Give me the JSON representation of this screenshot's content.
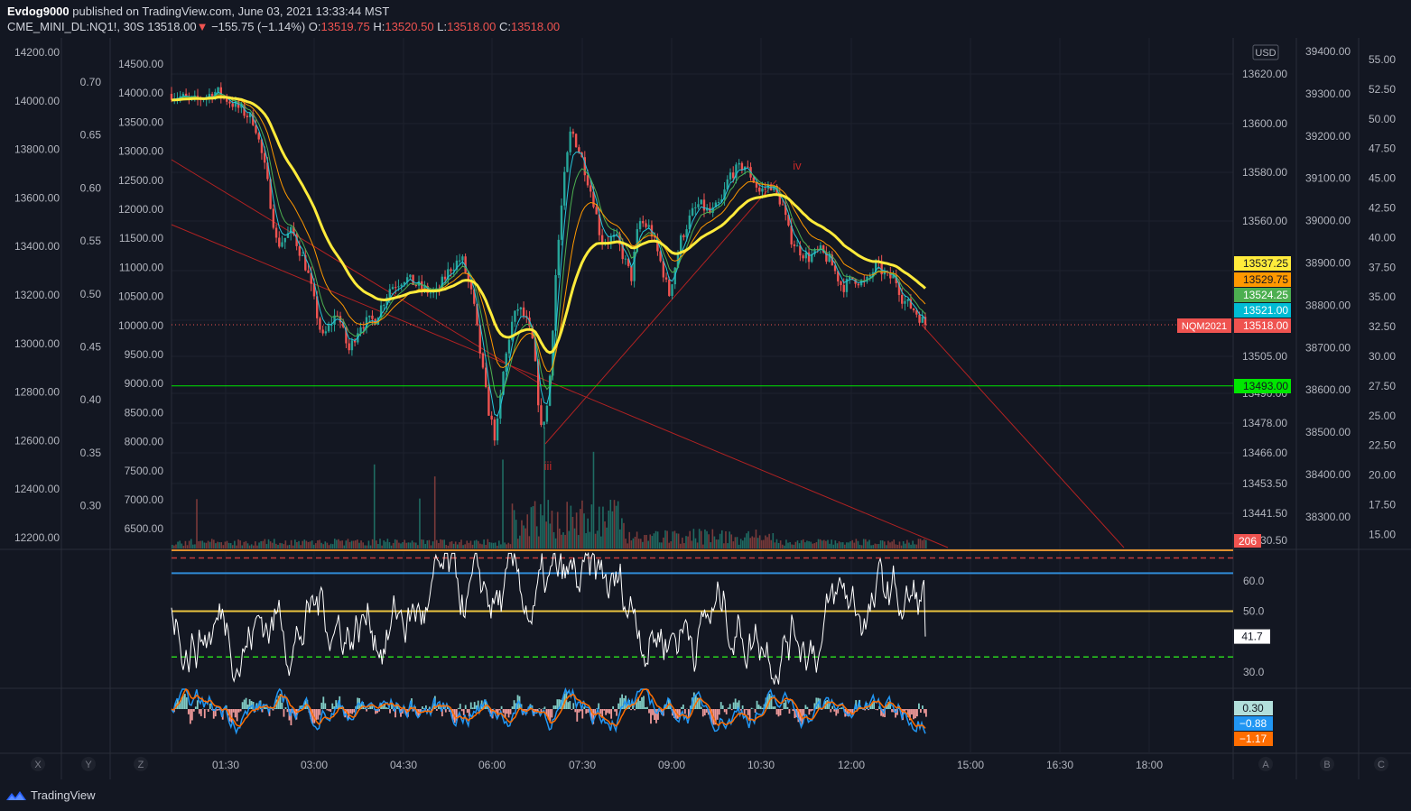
{
  "header": {
    "publisher": "Evdog9000",
    "published_text": "published on TradingView.com, June 03, 2021 13:33:44 MST",
    "symbol": "CME_MINI_DL:NQ1!, 30S",
    "last_price": "13518.00",
    "change": "−155.75 (−1.14%)",
    "open_label": "O:",
    "open": "13519.75",
    "high_label": "H:",
    "high": "13520.50",
    "low_label": "L:",
    "low": "13518.00",
    "close_label": "C:",
    "close": "13518.00"
  },
  "footer": {
    "brand": "TradingView"
  },
  "chart_data": [
    {
      "type": "candlestick",
      "title": "CME_MINI_DL:NQ1!, 30S",
      "currency": "USD",
      "x_ticks": [
        "01:30",
        "03:00",
        "04:30",
        "06:00",
        "07:30",
        "09:00",
        "10:30",
        "12:00",
        "15:00",
        "16:30",
        "18:00"
      ],
      "y_right_ticks": [
        "13620.00",
        "13600.00",
        "13580.00",
        "13560.00",
        "13505.00",
        "13490.00",
        "13478.00",
        "13466.00",
        "13453.50",
        "13441.50",
        "13430.50"
      ],
      "y_left_ticks": [
        "14200.00",
        "14000.00",
        "13800.00",
        "13600.00",
        "13400.00",
        "13200.00",
        "13000.00",
        "12800.00",
        "12600.00",
        "12400.00",
        "12200.00"
      ],
      "y_left2_ticks": [
        "0.70",
        "0.65",
        "0.60",
        "0.55",
        "0.50",
        "0.45",
        "0.40",
        "0.35",
        "0.30"
      ],
      "y_left3_ticks": [
        "14500.00",
        "14000.00",
        "13500.00",
        "13000.00",
        "12500.00",
        "12000.00",
        "11500.00",
        "11000.00",
        "10500.00",
        "10000.00",
        "9500.00",
        "9000.00",
        "8500.00",
        "8000.00",
        "7500.00",
        "7000.00",
        "6500.00"
      ],
      "y_right2_ticks": [
        "39400.00",
        "39300.00",
        "39200.00",
        "39100.00",
        "39000.00",
        "38900.00",
        "38800.00",
        "38700.00",
        "38600.00",
        "38500.00",
        "38400.00",
        "38300.00"
      ],
      "y_right3_ticks": [
        "55.00",
        "52.50",
        "50.00",
        "47.50",
        "45.00",
        "42.50",
        "40.00",
        "37.50",
        "35.00",
        "32.50",
        "30.00",
        "27.50",
        "25.00",
        "22.50",
        "20.00",
        "17.50",
        "15.00"
      ],
      "price_labels": [
        {
          "value": "13537.25",
          "color": "#ffeb3b"
        },
        {
          "value": "13529.75",
          "color": "#ff9800"
        },
        {
          "value": "13524.25",
          "color": "#4caf50"
        },
        {
          "value": "13521.00",
          "color": "#00bcd4"
        },
        {
          "value": "13518.00",
          "color": "#ef5350"
        },
        {
          "value": "13493.00",
          "color": "#00e600"
        }
      ],
      "symbol_tag": "NQM2021",
      "volume_label": "206",
      "annotations": [
        "iii",
        "iv"
      ],
      "horizontal_line": 13493.0,
      "close_path": [
        [
          0.0,
          13612
        ],
        [
          0.03,
          13609
        ],
        [
          0.06,
          13613
        ],
        [
          0.09,
          13606
        ],
        [
          0.11,
          13601
        ],
        [
          0.125,
          13580
        ],
        [
          0.14,
          13550
        ],
        [
          0.16,
          13556
        ],
        [
          0.18,
          13540
        ],
        [
          0.2,
          13512
        ],
        [
          0.22,
          13523
        ],
        [
          0.235,
          13507
        ],
        [
          0.25,
          13518
        ],
        [
          0.27,
          13520
        ],
        [
          0.29,
          13533
        ],
        [
          0.31,
          13537
        ],
        [
          0.33,
          13533
        ],
        [
          0.35,
          13530
        ],
        [
          0.37,
          13541
        ],
        [
          0.385,
          13545
        ],
        [
          0.4,
          13528
        ],
        [
          0.41,
          13505
        ],
        [
          0.42,
          13484
        ],
        [
          0.43,
          13471
        ],
        [
          0.44,
          13498
        ],
        [
          0.45,
          13517
        ],
        [
          0.46,
          13525
        ],
        [
          0.47,
          13520
        ],
        [
          0.48,
          13510
        ],
        [
          0.49,
          13475
        ],
        [
          0.5,
          13487
        ],
        [
          0.51,
          13540
        ],
        [
          0.52,
          13575
        ],
        [
          0.53,
          13598
        ],
        [
          0.545,
          13585
        ],
        [
          0.56,
          13568
        ],
        [
          0.57,
          13552
        ],
        [
          0.59,
          13553
        ],
        [
          0.61,
          13537
        ],
        [
          0.62,
          13560
        ],
        [
          0.635,
          13557
        ],
        [
          0.65,
          13542
        ],
        [
          0.66,
          13530
        ],
        [
          0.675,
          13552
        ],
        [
          0.69,
          13563
        ],
        [
          0.7,
          13567
        ],
        [
          0.715,
          13563
        ],
        [
          0.73,
          13568
        ],
        [
          0.74,
          13579
        ],
        [
          0.76,
          13583
        ],
        [
          0.77,
          13578
        ],
        [
          0.78,
          13572
        ],
        [
          0.795,
          13575
        ],
        [
          0.81,
          13567
        ],
        [
          0.82,
          13554
        ],
        [
          0.83,
          13549
        ],
        [
          0.845,
          13545
        ],
        [
          0.86,
          13548
        ],
        [
          0.875,
          13543
        ],
        [
          0.89,
          13533
        ],
        [
          0.905,
          13537
        ],
        [
          0.92,
          13534
        ],
        [
          0.935,
          13542
        ],
        [
          0.95,
          13537
        ],
        [
          0.96,
          13537
        ],
        [
          0.97,
          13528
        ],
        [
          0.985,
          13524
        ],
        [
          1.0,
          13518
        ]
      ]
    },
    {
      "type": "line",
      "title": "",
      "y_ticks": [
        "60.0",
        "50.0",
        "30.0"
      ],
      "ylim": [
        25,
        70
      ],
      "last_value_label": "41.7",
      "levels": [
        {
          "value": 70,
          "color": "#e0912e",
          "style": "solid"
        },
        {
          "value": 67.5,
          "color": "#c53b3b",
          "style": "dashed"
        },
        {
          "value": 62.5,
          "color": "#2f8ad6",
          "style": "solid"
        },
        {
          "value": 50,
          "color": "#e9c33f",
          "style": "solid"
        },
        {
          "value": 35,
          "color": "#2ad41e",
          "style": "dashed"
        }
      ]
    },
    {
      "type": "histogram",
      "title": "",
      "value_labels": [
        {
          "value": "0.30",
          "color": "#b2dfdb"
        },
        {
          "value": "−0.88",
          "color": "#2196f3"
        },
        {
          "value": "−1.17",
          "color": "#ff6d00"
        }
      ]
    }
  ],
  "axis_buttons": [
    "X",
    "Y",
    "Z",
    "A",
    "B",
    "C"
  ]
}
